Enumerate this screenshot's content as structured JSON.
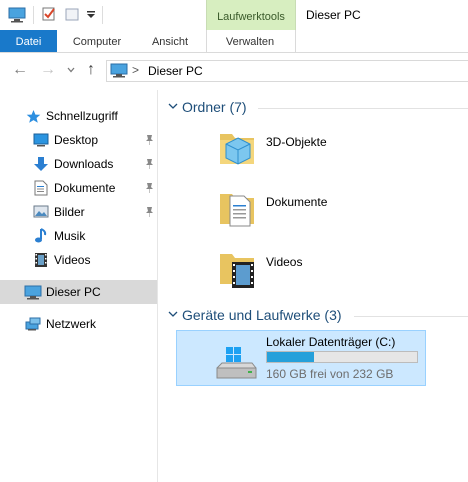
{
  "window": {
    "title": "Dieser PC"
  },
  "context_tab": {
    "label": "Laufwerktools"
  },
  "ribbon": {
    "tabs": [
      {
        "label": "Datei",
        "active": true
      },
      {
        "label": "Computer",
        "active": false
      },
      {
        "label": "Ansicht",
        "active": false
      },
      {
        "label": "Verwalten",
        "active": false
      }
    ]
  },
  "address": {
    "separator": ">",
    "path": "Dieser PC"
  },
  "sidebar": {
    "quick_access": "Schnellzugriff",
    "items": [
      {
        "label": "Desktop",
        "icon": "desktop-icon",
        "pinned": true
      },
      {
        "label": "Downloads",
        "icon": "downloads-icon",
        "pinned": true
      },
      {
        "label": "Dokumente",
        "icon": "documents-icon",
        "pinned": true
      },
      {
        "label": "Bilder",
        "icon": "pictures-icon",
        "pinned": true
      },
      {
        "label": "Musik",
        "icon": "music-icon",
        "pinned": false
      },
      {
        "label": "Videos",
        "icon": "videos-icon",
        "pinned": false
      }
    ],
    "this_pc": "Dieser PC",
    "network": "Netzwerk"
  },
  "folders": {
    "header": "Ordner (7)",
    "items": [
      {
        "label": "3D-Objekte",
        "icon": "3d-objects-folder-icon"
      },
      {
        "label": "Dokumente",
        "icon": "documents-folder-icon"
      },
      {
        "label": "Videos",
        "icon": "videos-folder-icon"
      }
    ]
  },
  "drives": {
    "header": "Geräte und Laufwerke (3)",
    "items": [
      {
        "label": "Lokaler Datenträger (C:)",
        "free_text": "160 GB frei von 232 GB",
        "used_fraction": 0.31
      }
    ]
  },
  "colors": {
    "accent": "#1979ca",
    "context_tab": "#d7eec0",
    "selection": "#cce8ff",
    "usage_bar": "#26a0da"
  }
}
